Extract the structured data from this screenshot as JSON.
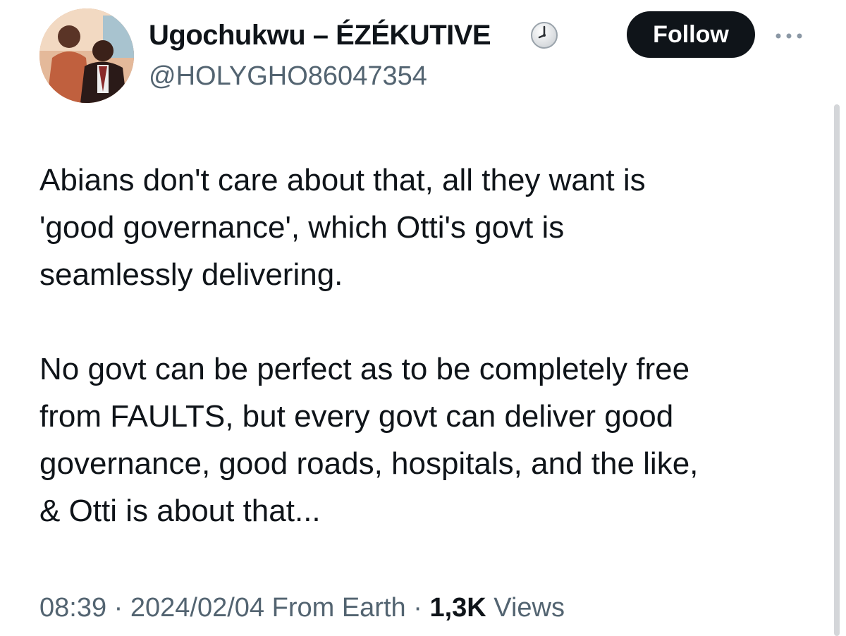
{
  "author": {
    "display_name": "Ugochukwu – ÉZÉKUTIVE",
    "handle": "@HOLYGHO86047354",
    "badge_icon": "clock-icon"
  },
  "actions": {
    "follow_label": "Follow",
    "more_icon": "more-horizontal-icon"
  },
  "tweet": {
    "text": "Abians don't care about that, all they want is\n'good governance', which Otti's govt is\nseamlessly delivering.\n\nNo govt can be perfect as to be completely free\nfrom FAULTS, but every govt can deliver good\ngovernance, good roads, hospitals, and the like,\n& Otti is about that..."
  },
  "meta": {
    "time": "08:39",
    "sep1": " · ",
    "date": "2024/02/04",
    "source": " From Earth",
    "sep2": " · ",
    "views_count": "1,3K",
    "views_label": " Views"
  },
  "colors": {
    "text": "#0f1419",
    "secondary": "#536471",
    "button_bg": "#0f1419",
    "button_text": "#ffffff",
    "background": "#ffffff"
  }
}
